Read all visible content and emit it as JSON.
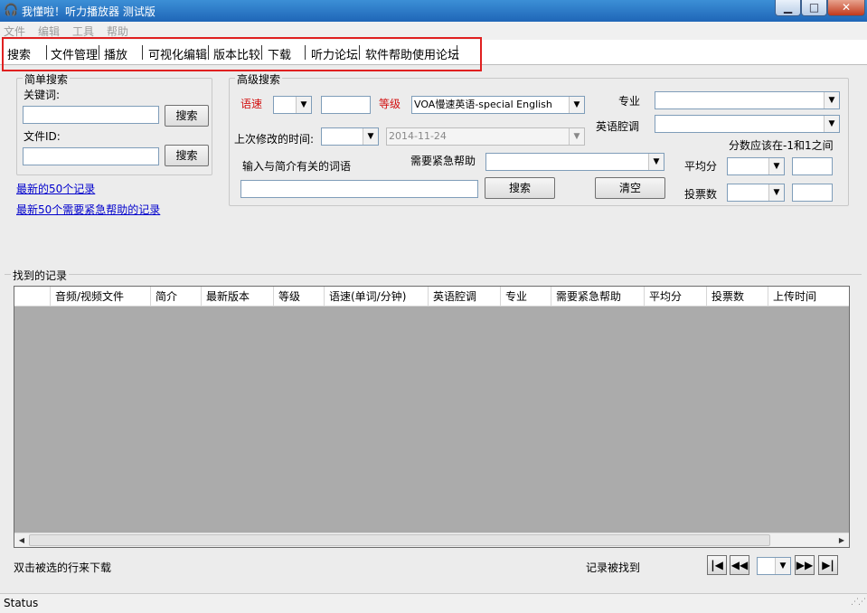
{
  "window": {
    "title": "我懂啦！听力播放器 测试版",
    "minimize": "▁",
    "maximize": "□",
    "close": "✕"
  },
  "menu": [
    "文件",
    "编辑",
    "工具",
    "帮助"
  ],
  "tabs": [
    "搜索",
    "文件管理",
    "播放",
    "可视化编辑",
    "版本比较",
    "下载",
    "听力论坛",
    "软件帮助使用论坛"
  ],
  "simple_search": {
    "title": "简单搜索",
    "keyword_label": "关键词:",
    "keyword_value": "",
    "fileid_label": "文件ID:",
    "fileid_value": "",
    "search_button_1": "搜索",
    "search_button_2": "搜索"
  },
  "links": {
    "latest50": "最新的50个记录",
    "latest50_help": "最新50个需要紧急帮助的记录"
  },
  "advanced_search": {
    "title": "高级搜索",
    "speed_label": "语速",
    "speed_op": "",
    "speed_value": "",
    "level_label": "等级",
    "level_value": "VOA慢速英语-special English",
    "major_label": "专业",
    "major_value": "",
    "accent_label": "英语腔调",
    "accent_value": "",
    "modified_label": "上次修改的时间:",
    "modified_op": "",
    "modified_date": "2014-11-24",
    "score_hint": "分数应该在-1和1之间",
    "intro_label": "输入与简介有关的词语",
    "intro_value": "",
    "help_label": "需要紧急帮助",
    "help_value": "",
    "avg_label": "平均分",
    "avg_op": "",
    "avg_value": "",
    "votes_label": "投票数",
    "votes_op": "",
    "votes_value": "",
    "search_button": "搜索",
    "clear_button": "清空"
  },
  "results": {
    "title": "找到的记录",
    "columns": [
      "音频/视频文件",
      "简介",
      "最新版本",
      "等级",
      "语速(单词/分钟)",
      "英语腔调",
      "专业",
      "需要紧急帮助",
      "平均分",
      "投票数",
      "上传时间"
    ],
    "rows": [],
    "hint": "双击被选的行来下载",
    "found_label": "记录被找到",
    "page_value": ""
  },
  "icons": {
    "first": "first-page-icon",
    "prev": "prev-page-icon",
    "next": "next-page-icon",
    "last": "last-page-icon",
    "dropdown": "chevron-down-icon"
  },
  "status": "Status"
}
